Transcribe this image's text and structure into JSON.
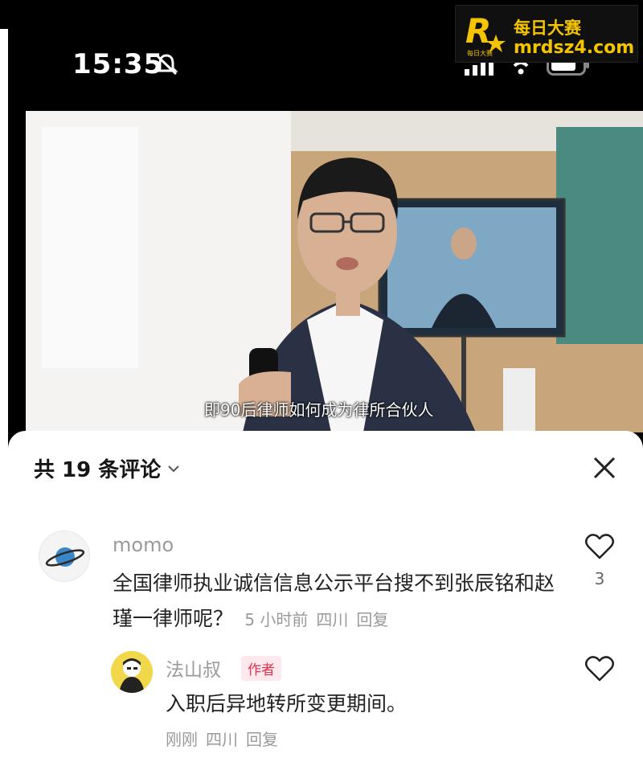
{
  "status_bar": {
    "time": "15:35"
  },
  "watermark": {
    "logo_letter": "R",
    "title": "每日大赛",
    "url": "mrdsz4.com",
    "logo_caption": "每日大赛"
  },
  "video": {
    "subtitle": "即90后律师如何成为律所合伙人"
  },
  "comments_panel": {
    "title": "共 19 条评论",
    "comments": [
      {
        "user": "momo",
        "text": "全国律师执业诚信信息公示平台搜不到张辰铭和赵瑾一律师呢？",
        "time": "5 小时前",
        "location": "四川",
        "reply_label": "回复",
        "likes": "3"
      },
      {
        "user": "法山叔",
        "badge": "作者",
        "text": "入职后异地转所变更期间。",
        "time": "刚刚",
        "location": "四川",
        "reply_label": "回复"
      }
    ]
  },
  "colors": {
    "accent_red": "#e0304e",
    "watermark_yellow": "#f5c400"
  },
  "icons": [
    "mute-icon",
    "signal-icon",
    "wifi-icon",
    "battery-icon",
    "chevron-down-icon",
    "close-icon",
    "heart-icon",
    "planet-icon"
  ]
}
